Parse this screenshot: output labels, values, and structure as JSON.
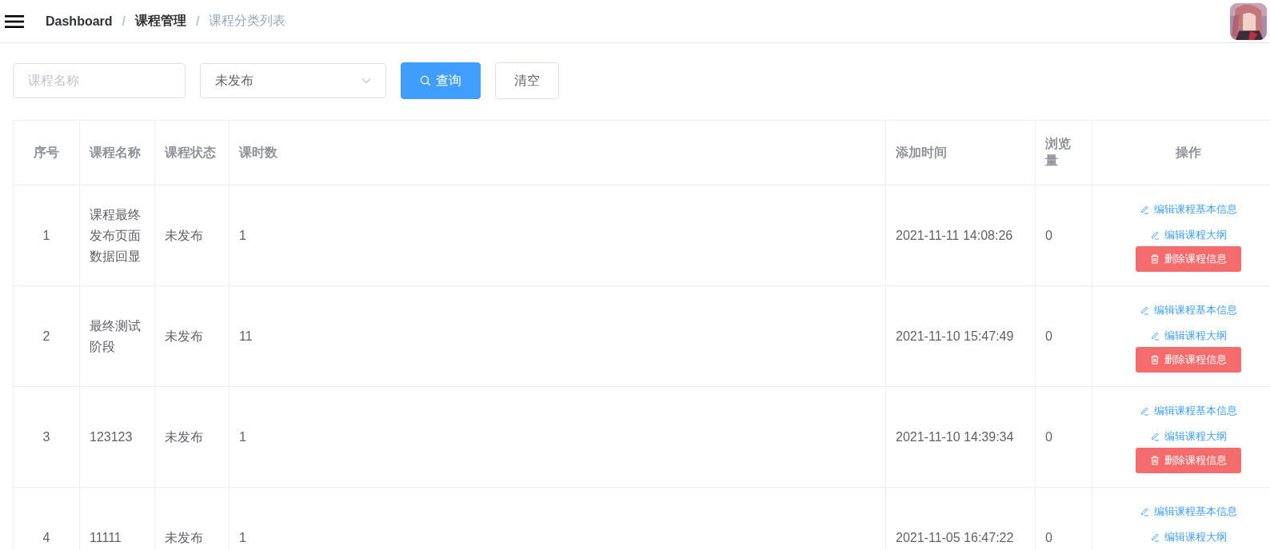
{
  "breadcrumb_separator": "/",
  "breadcrumb": [
    {
      "label": "Dashboard",
      "current": false
    },
    {
      "label": "课程管理",
      "current": false
    },
    {
      "label": "课程分类列表",
      "current": true
    }
  ],
  "filters": {
    "name": {
      "placeholder": "课程名称"
    },
    "status": {
      "value": "未发布"
    },
    "buttons": [
      {
        "label": "查询",
        "kind": "primary"
      },
      {
        "label": "清空",
        "kind": "plain"
      }
    ]
  },
  "table": {
    "columns": [
      "序号",
      "课程名称",
      "课程状态",
      "课时数",
      "添加时间",
      "浏览量",
      "操作"
    ],
    "rows": [
      {
        "cells": [
          "1",
          "课程最终发布页面数据回显",
          "未发布",
          "1",
          "2021-11-11 14:08:26",
          "0"
        ],
        "actions": [
          {
            "label": "编辑课程基本信息",
            "kind": "edit"
          },
          {
            "label": "编辑课程大纲",
            "kind": "edit"
          },
          {
            "label": "删除课程信息",
            "kind": "delete"
          }
        ]
      },
      {
        "cells": [
          "2",
          "最终测试阶段",
          "未发布",
          "11",
          "2021-11-10 15:47:49",
          "0"
        ],
        "actions": [
          {
            "label": "编辑课程基本信息",
            "kind": "edit"
          },
          {
            "label": "编辑课程大纲",
            "kind": "edit"
          },
          {
            "label": "删除课程信息",
            "kind": "delete"
          }
        ]
      },
      {
        "cells": [
          "3",
          "123123",
          "未发布",
          "1",
          "2021-11-10 14:39:34",
          "0"
        ],
        "actions": [
          {
            "label": "编辑课程基本信息",
            "kind": "edit"
          },
          {
            "label": "编辑课程大纲",
            "kind": "edit"
          },
          {
            "label": "删除课程信息",
            "kind": "delete"
          }
        ]
      },
      {
        "cells": [
          "4",
          "11111",
          "未发布",
          "1",
          "2021-11-05 16:47:22",
          "0"
        ],
        "actions": [
          {
            "label": "编辑课程基本信息",
            "kind": "edit"
          },
          {
            "label": "编辑课程大纲",
            "kind": "edit"
          }
        ]
      }
    ]
  }
}
